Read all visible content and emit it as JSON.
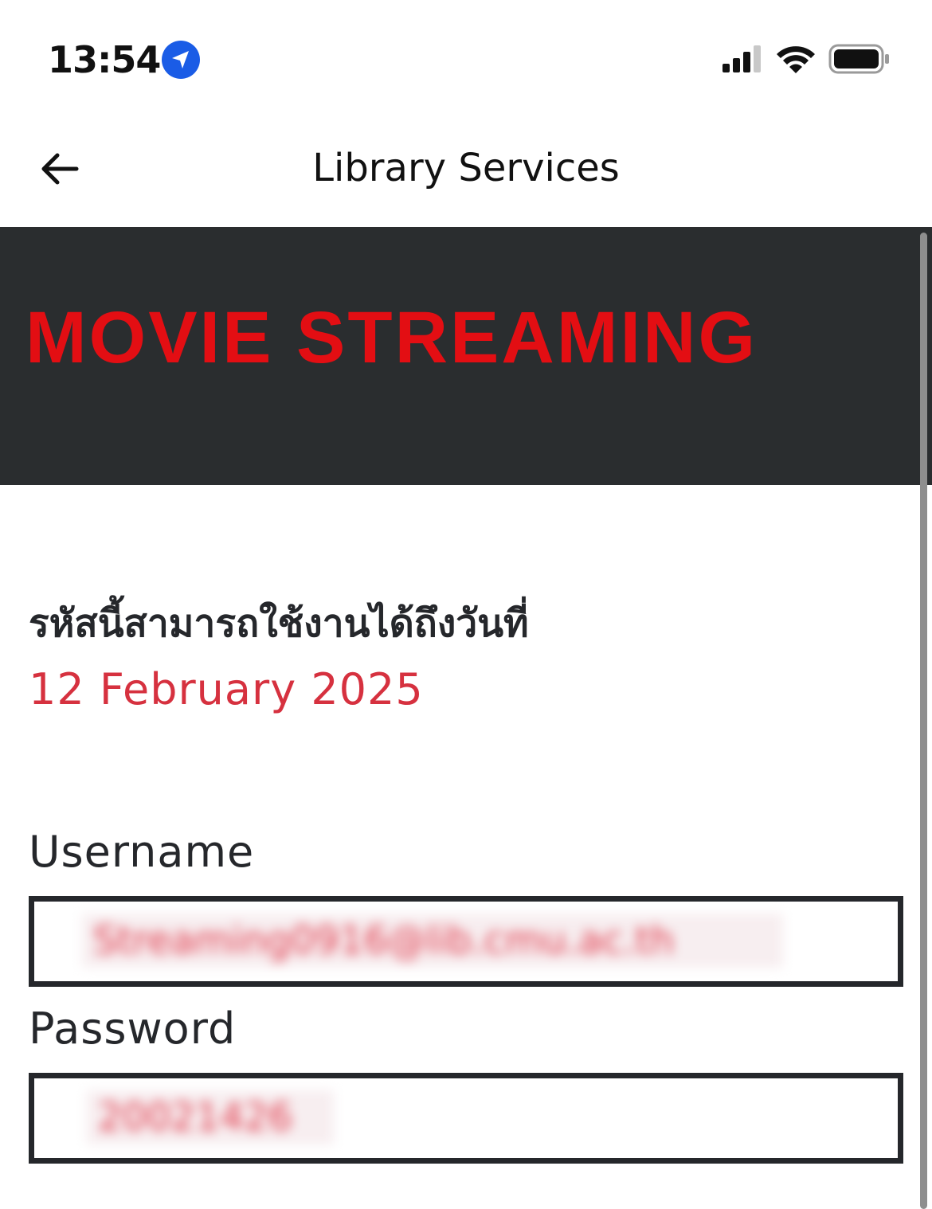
{
  "status_bar": {
    "time": "13:54",
    "icons": [
      "location-arrow-icon",
      "cellular-signal-icon",
      "wifi-icon",
      "battery-icon"
    ]
  },
  "header": {
    "title": "Library Services",
    "back_icon": "back-arrow-icon"
  },
  "banner": {
    "title": "MOVIE STREAMING",
    "background_color": "#2a2d2f",
    "title_color": "#e30e13"
  },
  "content": {
    "expiry_label": "รหัสนี้สามารถใช้งานได้ถึงวันที่",
    "expiry_date": "12 February 2025",
    "expiry_date_color": "#d6313f",
    "username": {
      "label": "Username",
      "value": "Streaming0916@lib.cmu.ac.th"
    },
    "password": {
      "label": "Password",
      "value": "20021426"
    }
  }
}
